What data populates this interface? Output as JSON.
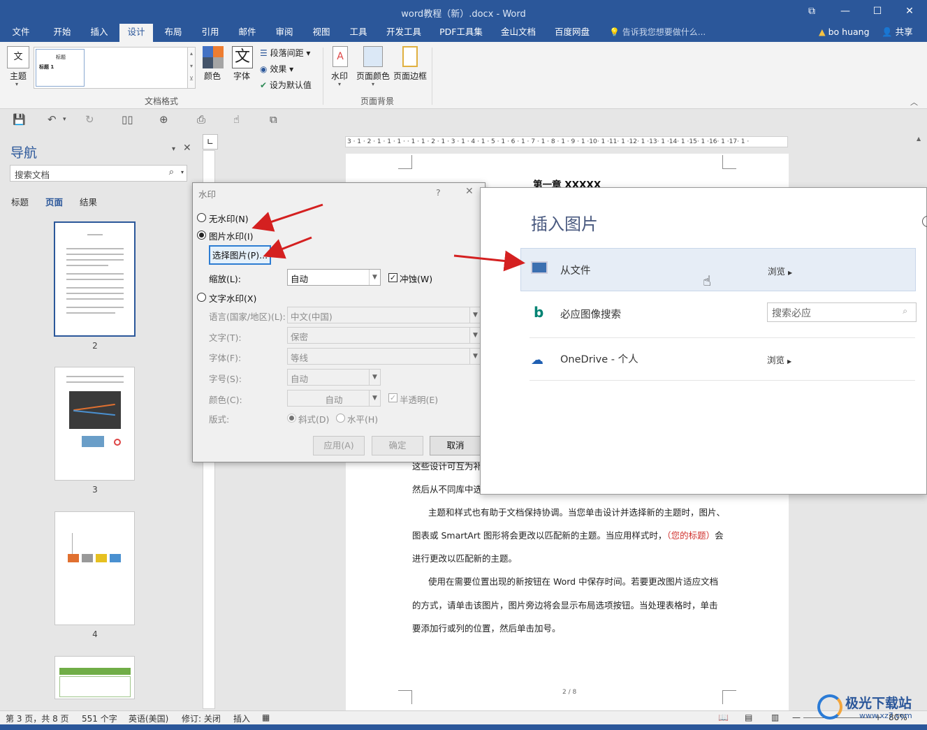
{
  "window": {
    "title": "word教程（新）.docx - Word",
    "controls": [
      "⧉",
      "—",
      "☐",
      "✕"
    ]
  },
  "tabs": [
    "文件",
    "开始",
    "插入",
    "设计",
    "布局",
    "引用",
    "邮件",
    "审阅",
    "视图",
    "工具",
    "开发工具",
    "PDF工具集",
    "金山文档",
    "百度网盘"
  ],
  "active_tab": "设计",
  "tell_me": "告诉我您想要做什么...",
  "user": "bo huang",
  "share": "共享",
  "ribbon": {
    "theme_label": "主题",
    "style_preview_title": "标题",
    "style_preview_heading": "标题 1",
    "colors_label": "颜色",
    "fonts_label": "字体",
    "paragraph_spacing": "段落间距",
    "effects": "效果",
    "set_default": "设为默认值",
    "group_document_format": "文档格式",
    "watermark_label": "水印",
    "page_color_label": "页面颜色",
    "page_border_label": "页面边框",
    "group_page_background": "页面背景"
  },
  "nav": {
    "title": "导航",
    "search_placeholder": "搜索文档",
    "tabs": [
      "标题",
      "页面",
      "结果"
    ],
    "active_tab": "页面",
    "page_numbers": [
      "2",
      "3",
      "4"
    ]
  },
  "document": {
    "heading": "第一章  XXXXX",
    "lines": [
      "这些设计可互为补充。例如，您可以添加匹配的封面、页眉和提要栏。单击\"插入\"，",
      "然后从不同库中选择所需元素。",
      "主题和样式也有助于文档保持协调。当您单击设计并选择新的主题时，图片、",
      "图表或  SmartArt  图形将会更改以匹配新的主题。当应用样式时，",
      "（您的标题）",
      "会",
      "进行更改以匹配新的主题。",
      "使用在需要位置出现的新按钮在  Word  中保存时间。若要更改图片适应文档",
      "的方式，请单击该图片，图片旁边将会显示布局选项按钮。当处理表格时，单击",
      "要添加行或列的位置，然后单击加号。"
    ],
    "page_footer": "2 / 8"
  },
  "ruler": "3 · 1 · 2 · 1 · 1 · 1 ·   · 1 · 1 · 2 · 1 · 3 · 1 · 4 · 1 · 5 · 1 · 6 · 1 · 7 · 1 · 8 · 1 · 9 · 1 ·10· 1 ·11· 1 ·12· 1 ·13· 1 ·14· 1 ·15· 1 ·16· 1 ·17· 1 ·",
  "watermark_dialog": {
    "title": "水印",
    "help": "?",
    "close": "✕",
    "no_watermark": "无水印(N)",
    "picture_watermark": "图片水印(I)",
    "select_picture": "选择图片(P)...",
    "scale_label": "缩放(L):",
    "scale_value": "自动",
    "washout": "冲蚀(W)",
    "text_watermark": "文字水印(X)",
    "language_label": "语言(国家/地区)(L):",
    "language_value": "中文(中国)",
    "text_label": "文字(T):",
    "text_value": "保密",
    "font_label": "字体(F):",
    "font_value": "等线",
    "size_label": "字号(S):",
    "size_value": "自动",
    "color_label": "颜色(C):",
    "color_value": "自动",
    "semitransparent": "半透明(E)",
    "layout_label": "版式:",
    "diagonal": "斜式(D)",
    "horizontal": "水平(H)",
    "apply": "应用(A)",
    "ok": "确定",
    "cancel": "取消",
    "selected_option": "picture_watermark"
  },
  "insert_picture": {
    "title": "插入图片",
    "from_file": "从文件",
    "browse": "浏览",
    "bing": "必应图像搜索",
    "bing_search_placeholder": "搜索必应",
    "onedrive": "OneDrive - 个人",
    "browse2": "浏览"
  },
  "status": {
    "page": "第 3 页，共 8 页",
    "words": "551 个字",
    "language": "英语(美国)",
    "revision": "修订: 关闭",
    "insert": "插入",
    "zoom": "80%"
  },
  "site_logo": {
    "text": "极光下载站",
    "url": "www.xz7.com"
  },
  "colors": {
    "word_blue": "#2b579a",
    "arrow_red": "#d42020",
    "link_blue": "#2d7dd2"
  }
}
